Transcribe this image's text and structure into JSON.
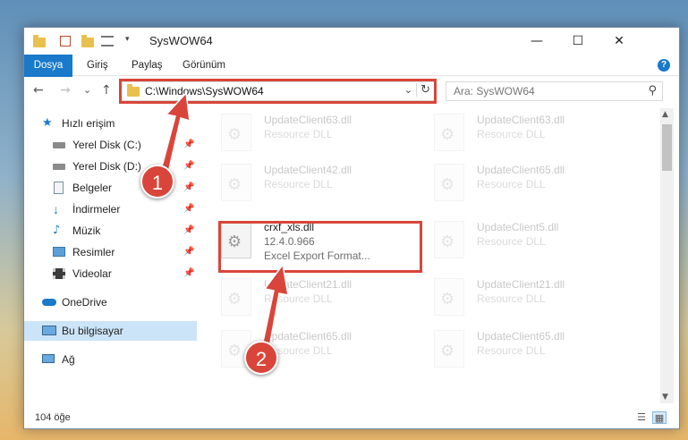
{
  "window": {
    "title": "SysWOW64",
    "minimize_glyph": "—",
    "maximize_glyph": "☐",
    "close_glyph": "✕"
  },
  "ribbon": {
    "tabs": [
      "Dosya",
      "Giriş",
      "Paylaş",
      "Görünüm"
    ],
    "help_glyph": "?"
  },
  "nav": {
    "back_glyph": "←",
    "forward_glyph": "→",
    "recent_glyph": "⌄",
    "up_glyph": "↑"
  },
  "address": {
    "path": "C:\\Windows\\SysWOW64",
    "dropdown_glyph": "⌄",
    "refresh_glyph": "↻"
  },
  "search": {
    "placeholder": "Ara: SysWOW64",
    "icon_glyph": "⚲"
  },
  "sidebar": {
    "items": [
      {
        "label": "Hızlı erişim",
        "icon": "star-icon"
      },
      {
        "label": "Yerel Disk (C:)",
        "icon": "drive-icon",
        "pinned": true
      },
      {
        "label": "Yerel Disk (D:)",
        "icon": "drive-icon",
        "pinned": true
      },
      {
        "label": "Belgeler",
        "icon": "documents-icon",
        "pinned": true
      },
      {
        "label": "İndirmeler",
        "icon": "download-icon",
        "pinned": true
      },
      {
        "label": "Müzik",
        "icon": "music-icon",
        "pinned": true
      },
      {
        "label": "Resimler",
        "icon": "pictures-icon",
        "pinned": true
      },
      {
        "label": "Videolar",
        "icon": "video-icon",
        "pinned": true
      },
      {
        "label": "OneDrive",
        "icon": "cloud-icon"
      },
      {
        "label": "Bu bilgisayar",
        "icon": "computer-icon",
        "selected": true
      },
      {
        "label": "Ağ",
        "icon": "network-icon"
      }
    ],
    "pin_glyph": "📌"
  },
  "files": {
    "background": [
      {
        "name": "UpdateClient63.dll",
        "desc": "Resource DLL"
      },
      {
        "name": "UpdateClient63.dll",
        "desc": "Resource DLL"
      },
      {
        "name": "UpdateClient42.dll",
        "desc": "Resource DLL"
      },
      {
        "name": "UpdateClient65.dll",
        "desc": "Resource DLL"
      },
      {
        "name": "UpdateClient5.dll",
        "desc": "Resource DLL"
      },
      {
        "name": "UpdateClient21.dll",
        "desc": "Resource DLL"
      },
      {
        "name": "UpdateClient21.dll",
        "desc": "Resource DLL"
      },
      {
        "name": "UpdateClient65.dll",
        "desc": "Resource DLL"
      },
      {
        "name": "UpdateClient65.dll",
        "desc": "Resource DLL"
      }
    ],
    "highlighted": {
      "name": "crxf_xls.dll",
      "version": "12.4.0.966",
      "desc": "Excel Export Format..."
    }
  },
  "status": {
    "count": "104 öğe"
  },
  "callouts": {
    "one": "1",
    "two": "2",
    "color": "#d9453a"
  },
  "colors": {
    "accent": "#1979ca",
    "selection": "#cce4f7",
    "highlight": "#d9453a"
  }
}
